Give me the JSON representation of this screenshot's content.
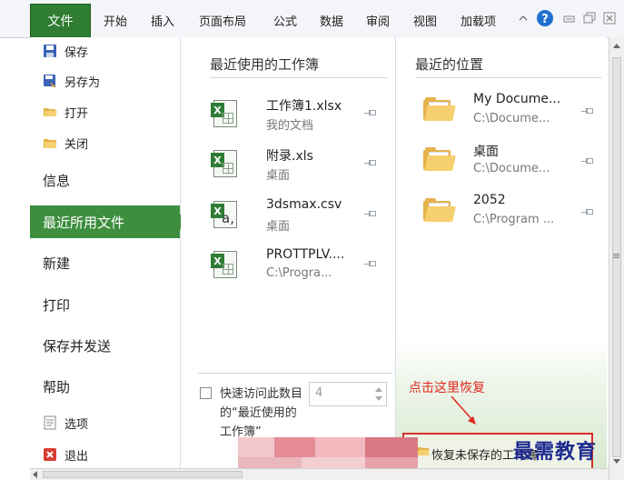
{
  "ribbon": {
    "tabs": [
      "文件",
      "开始",
      "插入",
      "页面布局",
      "公式",
      "数据",
      "审阅",
      "视图",
      "加载项"
    ],
    "colors": {
      "file_tab": "#2e7d32",
      "help": "#1f6fd1"
    }
  },
  "sidebar": {
    "items": [
      {
        "label": "保存",
        "icon": "save-icon"
      },
      {
        "label": "另存为",
        "icon": "save-as-icon"
      },
      {
        "label": "打开",
        "icon": "open-folder-icon"
      },
      {
        "label": "关闭",
        "icon": "close-folder-icon"
      },
      {
        "label": "信息"
      },
      {
        "label": "最近所用文件",
        "selected": true
      },
      {
        "label": "新建"
      },
      {
        "label": "打印"
      },
      {
        "label": "保存并发送"
      },
      {
        "label": "帮助"
      },
      {
        "label": "选项",
        "icon": "options-icon"
      },
      {
        "label": "退出",
        "icon": "exit-icon"
      }
    ],
    "accent": "#3d8f3f"
  },
  "recent": {
    "title": "最近使用的工作簿",
    "files": [
      {
        "name": "工作簿1.xlsx",
        "path": "我的文档",
        "icon": "excel-file-icon"
      },
      {
        "name": "附录.xls",
        "path": "桌面",
        "icon": "excel-file-icon"
      },
      {
        "name": "3dsmax.csv",
        "path": "桌面",
        "icon": "csv-file-icon"
      },
      {
        "name": "PROTTPLV....",
        "path": "C:\\Progra...",
        "icon": "excel-file-icon"
      }
    ],
    "quick_access": {
      "label": "快速访问此数目的“最近使用的工作簿”",
      "value": "4",
      "checked": false
    }
  },
  "places": {
    "title": "最近的位置",
    "items": [
      {
        "name": "My Docume...",
        "path": "C:\\Docume..."
      },
      {
        "name": "桌面",
        "path": "C:\\Docume..."
      },
      {
        "name": "2052",
        "path": "C:\\Program ..."
      }
    ],
    "recover_button": "恢复未保存的工作簿"
  },
  "annotation": {
    "text": "点击这里恢复",
    "color": "#e0281e"
  },
  "watermark": "最需教育"
}
